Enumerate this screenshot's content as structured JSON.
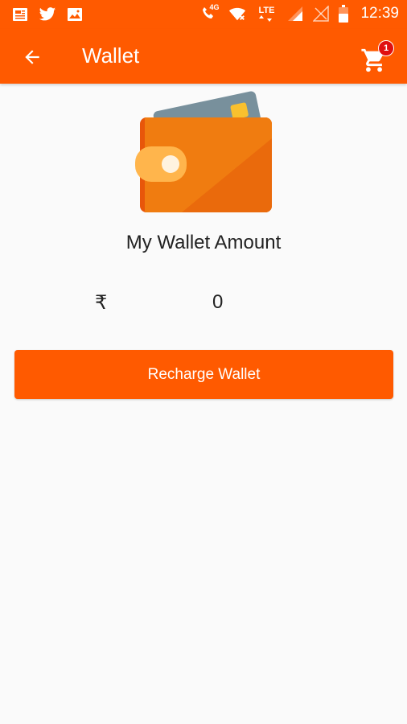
{
  "status_bar": {
    "time": "12:39",
    "network_label": "4G",
    "lte_label": "LTE",
    "icons": [
      "news-icon",
      "twitter-icon",
      "image-icon",
      "call-4g-icon",
      "wifi-icon",
      "lte-icon",
      "signal-icon",
      "signal-empty-icon",
      "battery-icon"
    ]
  },
  "toolbar": {
    "title": "Wallet",
    "cart_count": "1"
  },
  "wallet": {
    "amount_label": "My Wallet Amount",
    "currency_symbol": "₹",
    "amount": "0",
    "recharge_label": "Recharge Wallet"
  },
  "colors": {
    "brand": "#ff5a00",
    "badge": "#e01010",
    "background": "#fafafa"
  }
}
